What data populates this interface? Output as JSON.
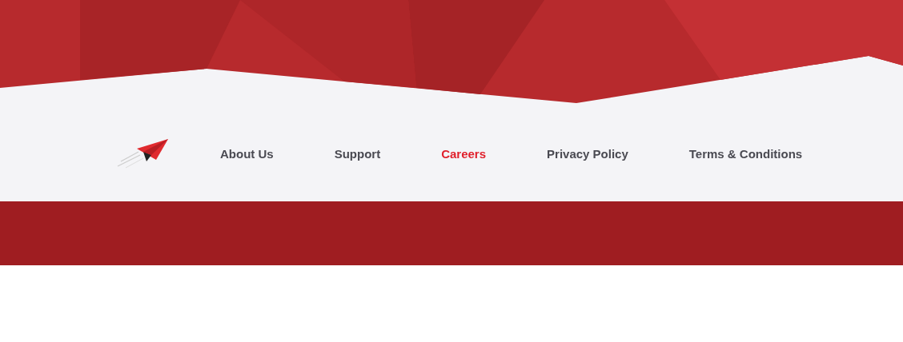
{
  "nav": {
    "items": [
      {
        "label": "About Us",
        "selected": false
      },
      {
        "label": "Support",
        "selected": false
      },
      {
        "label": "Careers",
        "selected": true
      },
      {
        "label": "Privacy Policy",
        "selected": false
      },
      {
        "label": "Terms & Conditions",
        "selected": false
      }
    ]
  }
}
